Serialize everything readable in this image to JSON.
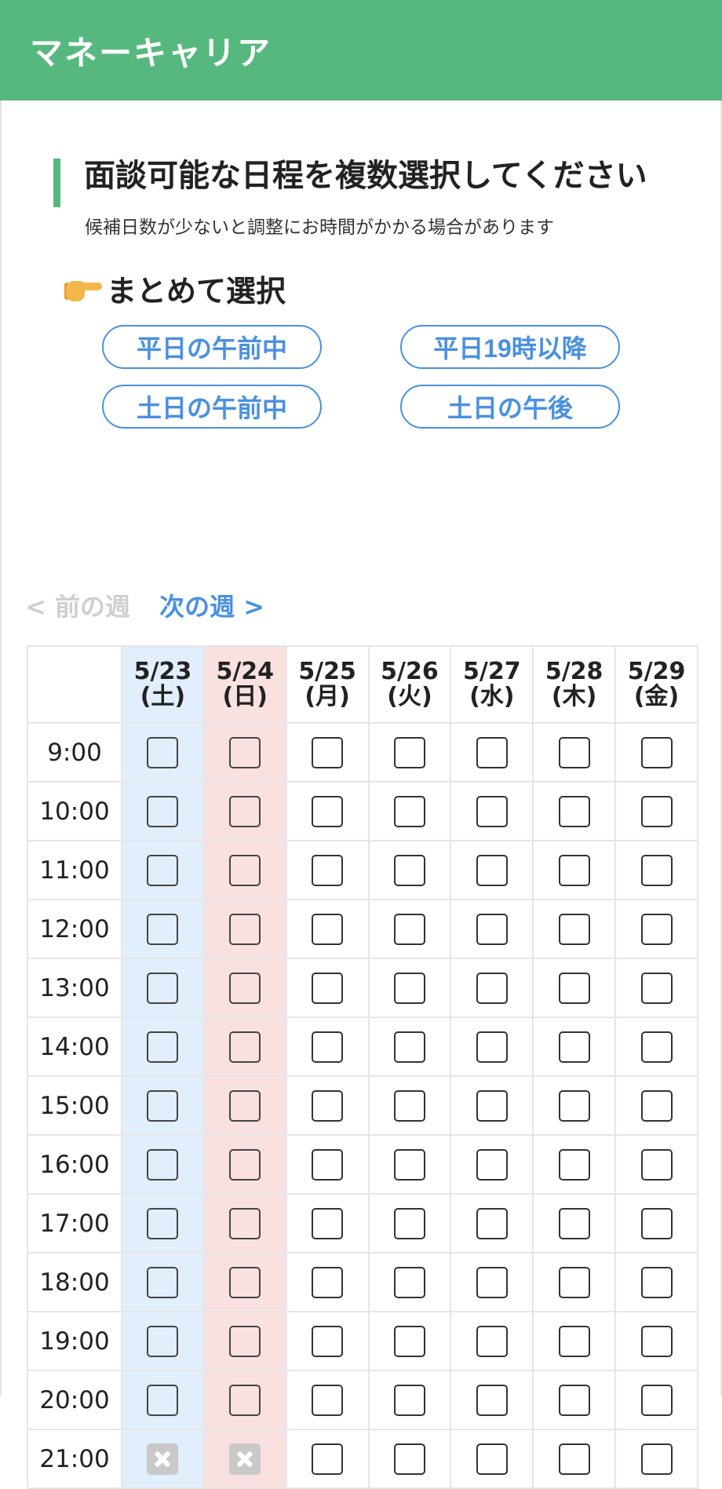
{
  "header": {
    "logo": "マネーキャリア"
  },
  "heading": {
    "title": "面談可能な日程を複数選択してください",
    "subtitle": "候補日数が少ないと調整にお時間がかかる場合があります"
  },
  "bulk_select": {
    "title": "まとめて選択",
    "buttons": [
      "平日の午前中",
      "平日19時以降",
      "土日の午前中",
      "土日の午後"
    ]
  },
  "week_nav": {
    "prev": "< 前の週",
    "next": "次の週 >"
  },
  "schedule": {
    "days": [
      {
        "date": "5/23",
        "weekday": "(土)",
        "type": "sat"
      },
      {
        "date": "5/24",
        "weekday": "(日)",
        "type": "sun"
      },
      {
        "date": "5/25",
        "weekday": "(月)",
        "type": "wk"
      },
      {
        "date": "5/26",
        "weekday": "(火)",
        "type": "wk"
      },
      {
        "date": "5/27",
        "weekday": "(水)",
        "type": "wk"
      },
      {
        "date": "5/28",
        "weekday": "(木)",
        "type": "wk"
      },
      {
        "date": "5/29",
        "weekday": "(金)",
        "type": "wk"
      }
    ],
    "times": [
      "9:00",
      "10:00",
      "11:00",
      "12:00",
      "13:00",
      "14:00",
      "15:00",
      "16:00",
      "17:00",
      "18:00",
      "19:00",
      "20:00",
      "21:00"
    ],
    "unavailable": [
      {
        "time": "21:00",
        "date": "5/23"
      },
      {
        "time": "21:00",
        "date": "5/24"
      }
    ]
  },
  "colors": {
    "brand": "#57b87f",
    "link": "#4a90e2",
    "saturday_bg": "#e1eefb",
    "sunday_bg": "#f9e1e1"
  }
}
